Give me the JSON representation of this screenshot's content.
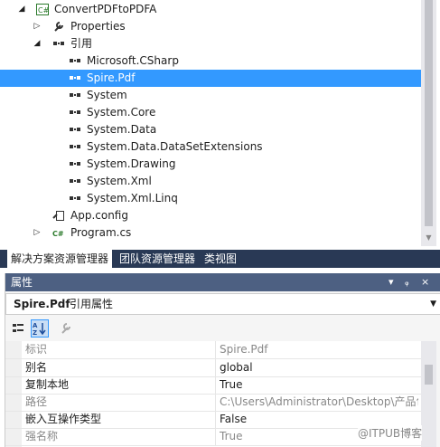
{
  "explorer": {
    "items": [
      {
        "label": "ConvertPDFtoPDFA",
        "expander": "◢",
        "icon": "csharp-project-icon"
      },
      {
        "label": "Properties",
        "expander": "▷",
        "icon": "wrench-icon"
      },
      {
        "label": "引用",
        "expander": "◢",
        "icon": "references-icon"
      },
      {
        "label": "Microsoft.CSharp",
        "icon": "reference-icon"
      },
      {
        "label": "Spire.Pdf",
        "icon": "reference-icon",
        "selected": true
      },
      {
        "label": "System",
        "icon": "reference-icon"
      },
      {
        "label": "System.Core",
        "icon": "reference-icon"
      },
      {
        "label": "System.Data",
        "icon": "reference-icon"
      },
      {
        "label": "System.Data.DataSetExtensions",
        "icon": "reference-icon"
      },
      {
        "label": "System.Drawing",
        "icon": "reference-icon"
      },
      {
        "label": "System.Xml",
        "icon": "reference-icon"
      },
      {
        "label": "System.Xml.Linq",
        "icon": "reference-icon"
      },
      {
        "label": "App.config",
        "icon": "config-icon"
      },
      {
        "label": "Program.cs",
        "expander": "▷",
        "icon": "csharp-file-icon"
      }
    ]
  },
  "tabs": [
    "解决方案资源管理器",
    "团队资源管理器",
    "类视图"
  ],
  "properties": {
    "title": "属性",
    "pin_glyph": "ᵩ",
    "close_glyph": "×",
    "menu_glyph": "▾",
    "object_name": "Spire.Pdf",
    "object_kind": "引用属性",
    "rows": [
      {
        "key": "标识",
        "value": "Spire.Pdf",
        "disabled": true
      },
      {
        "key": "别名",
        "value": "global"
      },
      {
        "key": "复制本地",
        "value": "True"
      },
      {
        "key": "路径",
        "value": "C:\\Users\\Administrator\\Desktop\\产品包",
        "disabled": true
      },
      {
        "key": "嵌入互操作类型",
        "value": "False"
      },
      {
        "key": "强名称",
        "value": "True",
        "disabled": true
      }
    ]
  },
  "watermark": "@ITPUB博客",
  "colors": {
    "selection": "#3399ff",
    "tab_strip": "#293955",
    "panel_header": "#4d6082"
  }
}
